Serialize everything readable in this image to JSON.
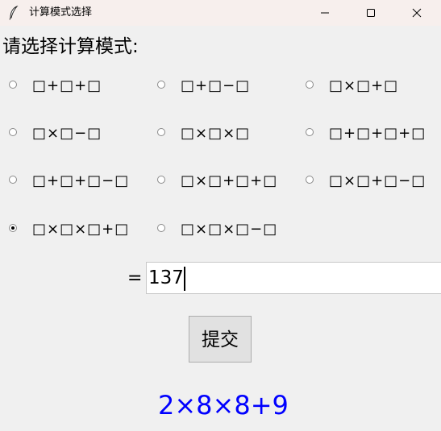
{
  "window": {
    "title": "计算模式选择",
    "app_icon": "feather-icon",
    "controls": [
      "minimize-icon",
      "maximize-icon",
      "close-icon"
    ]
  },
  "prompt": "请选择计算模式:",
  "options": [
    {
      "label": "□+□+□",
      "checked": false
    },
    {
      "label": "□+□−□",
      "checked": false
    },
    {
      "label": "□×□+□",
      "checked": false
    },
    {
      "label": "□×□−□",
      "checked": false
    },
    {
      "label": "□×□×□",
      "checked": false
    },
    {
      "label": "□+□+□+□",
      "checked": false
    },
    {
      "label": "□+□+□−□",
      "checked": false
    },
    {
      "label": "□×□+□+□",
      "checked": false
    },
    {
      "label": "□×□+□−□",
      "checked": false
    },
    {
      "label": "□×□×□+□",
      "checked": true
    },
    {
      "label": "□×□×□−□",
      "checked": false
    }
  ],
  "answer": {
    "eq_sign": "=",
    "value": "137"
  },
  "submit_label": "提交",
  "result": "2×8×8+9",
  "colors": {
    "result_text": "#0000ff",
    "titlebar_bg": "#f7efed",
    "window_bg": "#f0f0f0"
  }
}
